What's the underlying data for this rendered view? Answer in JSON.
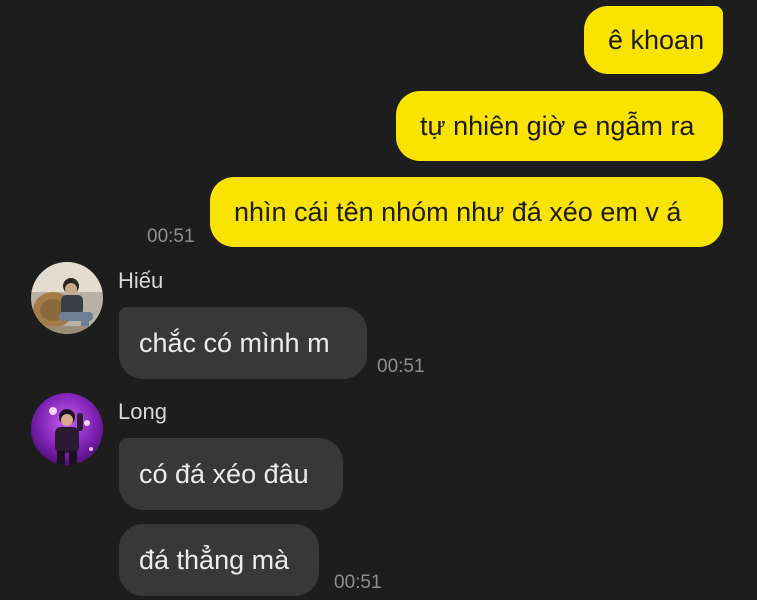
{
  "conversation": {
    "outgoing": [
      {
        "text": "ê khoan"
      },
      {
        "text": "tự nhiên giờ e ngẫm ra"
      },
      {
        "text": "nhìn cái tên nhóm như đá xéo em v á",
        "time": "00:51"
      }
    ],
    "incoming": [
      {
        "sender": "Hiếu",
        "avatar_icon": "user-photo-hieu",
        "messages": [
          {
            "text": "chắc có mình m",
            "time": "00:51"
          }
        ]
      },
      {
        "sender": "Long",
        "avatar_icon": "user-photo-long",
        "messages": [
          {
            "text": "có đá xéo đâu"
          },
          {
            "text": "đá thẳng mà",
            "time": "00:51"
          }
        ]
      }
    ]
  },
  "colors": {
    "background": "#1d1d1d",
    "outgoing_bubble": "#fbe300",
    "incoming_bubble": "#383838",
    "timestamp": "#8f8f8f"
  }
}
